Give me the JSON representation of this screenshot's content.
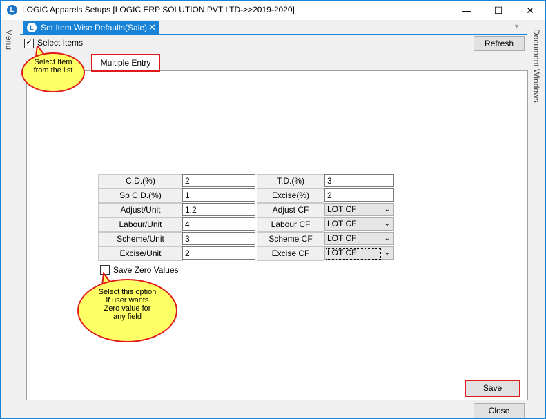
{
  "window": {
    "title": "LOGIC Apparels Setups  [LOGIC ERP SOLUTION PVT LTD->>2019-2020]",
    "minimize": "—",
    "maximize": "☐",
    "close": "✕"
  },
  "side": {
    "left_label": "Menu",
    "right_label": "Document Windows"
  },
  "tab": {
    "label": "Set Item Wise Defaults(Sale)",
    "close": "✕",
    "dropdown": "▼"
  },
  "select_items": {
    "label": "Select Items",
    "checked": true
  },
  "refresh_label": "Refresh",
  "subtab_label": "Multiple Entry",
  "fields_left": [
    {
      "label": "C.D.(%)",
      "value": "2"
    },
    {
      "label": "Sp C.D.(%)",
      "value": "1"
    },
    {
      "label": "Adjust/Unit",
      "value": "1.2"
    },
    {
      "label": "Labour/Unit",
      "value": "4"
    },
    {
      "label": "Scheme/Unit",
      "value": "3"
    },
    {
      "label": "Excise/Unit",
      "value": "2"
    }
  ],
  "fields_right": [
    {
      "label": "T.D.(%)",
      "value": "3"
    },
    {
      "label": "Excise(%)",
      "value": "2"
    },
    {
      "label": "Adjust CF",
      "value": "LOT CF"
    },
    {
      "label": "Labour CF",
      "value": "LOT CF"
    },
    {
      "label": "Scheme CF",
      "value": "LOT CF"
    },
    {
      "label": "Excise CF",
      "value": "LOT CF"
    }
  ],
  "save_zero": {
    "label": "Save Zero Values",
    "checked": false
  },
  "callouts": {
    "select_item": [
      "Select  Item",
      "from  the  list"
    ],
    "save_zero": [
      "Select  this  option",
      "if  user  wants",
      "Zero  value  for",
      "any  field"
    ]
  },
  "save_label": "Save",
  "close_label": "Close",
  "colors": {
    "accent": "#1883d7",
    "highlight": "#e0191b",
    "callout_fill": "#ffff66"
  }
}
